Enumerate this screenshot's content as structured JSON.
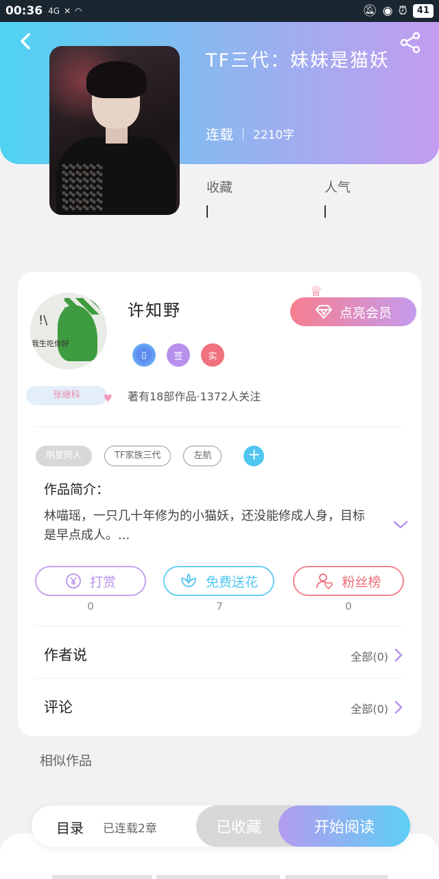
{
  "status_bar": {
    "time": "00:36",
    "signal1": "4G",
    "signal2": "✕",
    "battery": "41"
  },
  "header": {
    "back_icon": "chevron-left-icon",
    "share_icon": "share-icon",
    "book_title": "TF三代：妹妹是猫妖",
    "status": "连载",
    "word_count": "2210字",
    "stat_favorites_label": "收藏",
    "stat_popularity_label": "人气"
  },
  "author": {
    "name": "许知野",
    "avatar_text": "我生吃你好",
    "badge": "张继科",
    "vip_button": "点亮会员",
    "badges": [
      "▯",
      "签",
      "实"
    ],
    "stats": "著有18部作品·1372人关注"
  },
  "tags": [
    "明星同人",
    "TF家族三代",
    "左航"
  ],
  "intro": {
    "title": "作品简介：",
    "text": "林喵瑶，一只几十年修为的小猫妖，还没能修成人身，目标是早点成人。..."
  },
  "actions": [
    {
      "label": "打赏",
      "count": "0",
      "icon": "yen-icon",
      "color": "#b690ec"
    },
    {
      "label": "免费送花",
      "count": "7",
      "icon": "flower-icon",
      "color": "#4fc6f0"
    },
    {
      "label": "粉丝榜",
      "count": "0",
      "icon": "fans-icon",
      "color": "#ef6b78"
    }
  ],
  "rows": [
    {
      "label": "作者说",
      "right": "全部(0)"
    },
    {
      "label": "评论",
      "right": "全部(0)"
    }
  ],
  "similar_title": "相似作品",
  "bottom_bar": {
    "toc": "目录",
    "serial": "已连载2章",
    "collected": "已收藏",
    "read": "开始阅读"
  },
  "colors": {
    "accent_start": "#4fd3f3",
    "accent_end": "#c39cf0",
    "vip": "#f67e8e"
  }
}
